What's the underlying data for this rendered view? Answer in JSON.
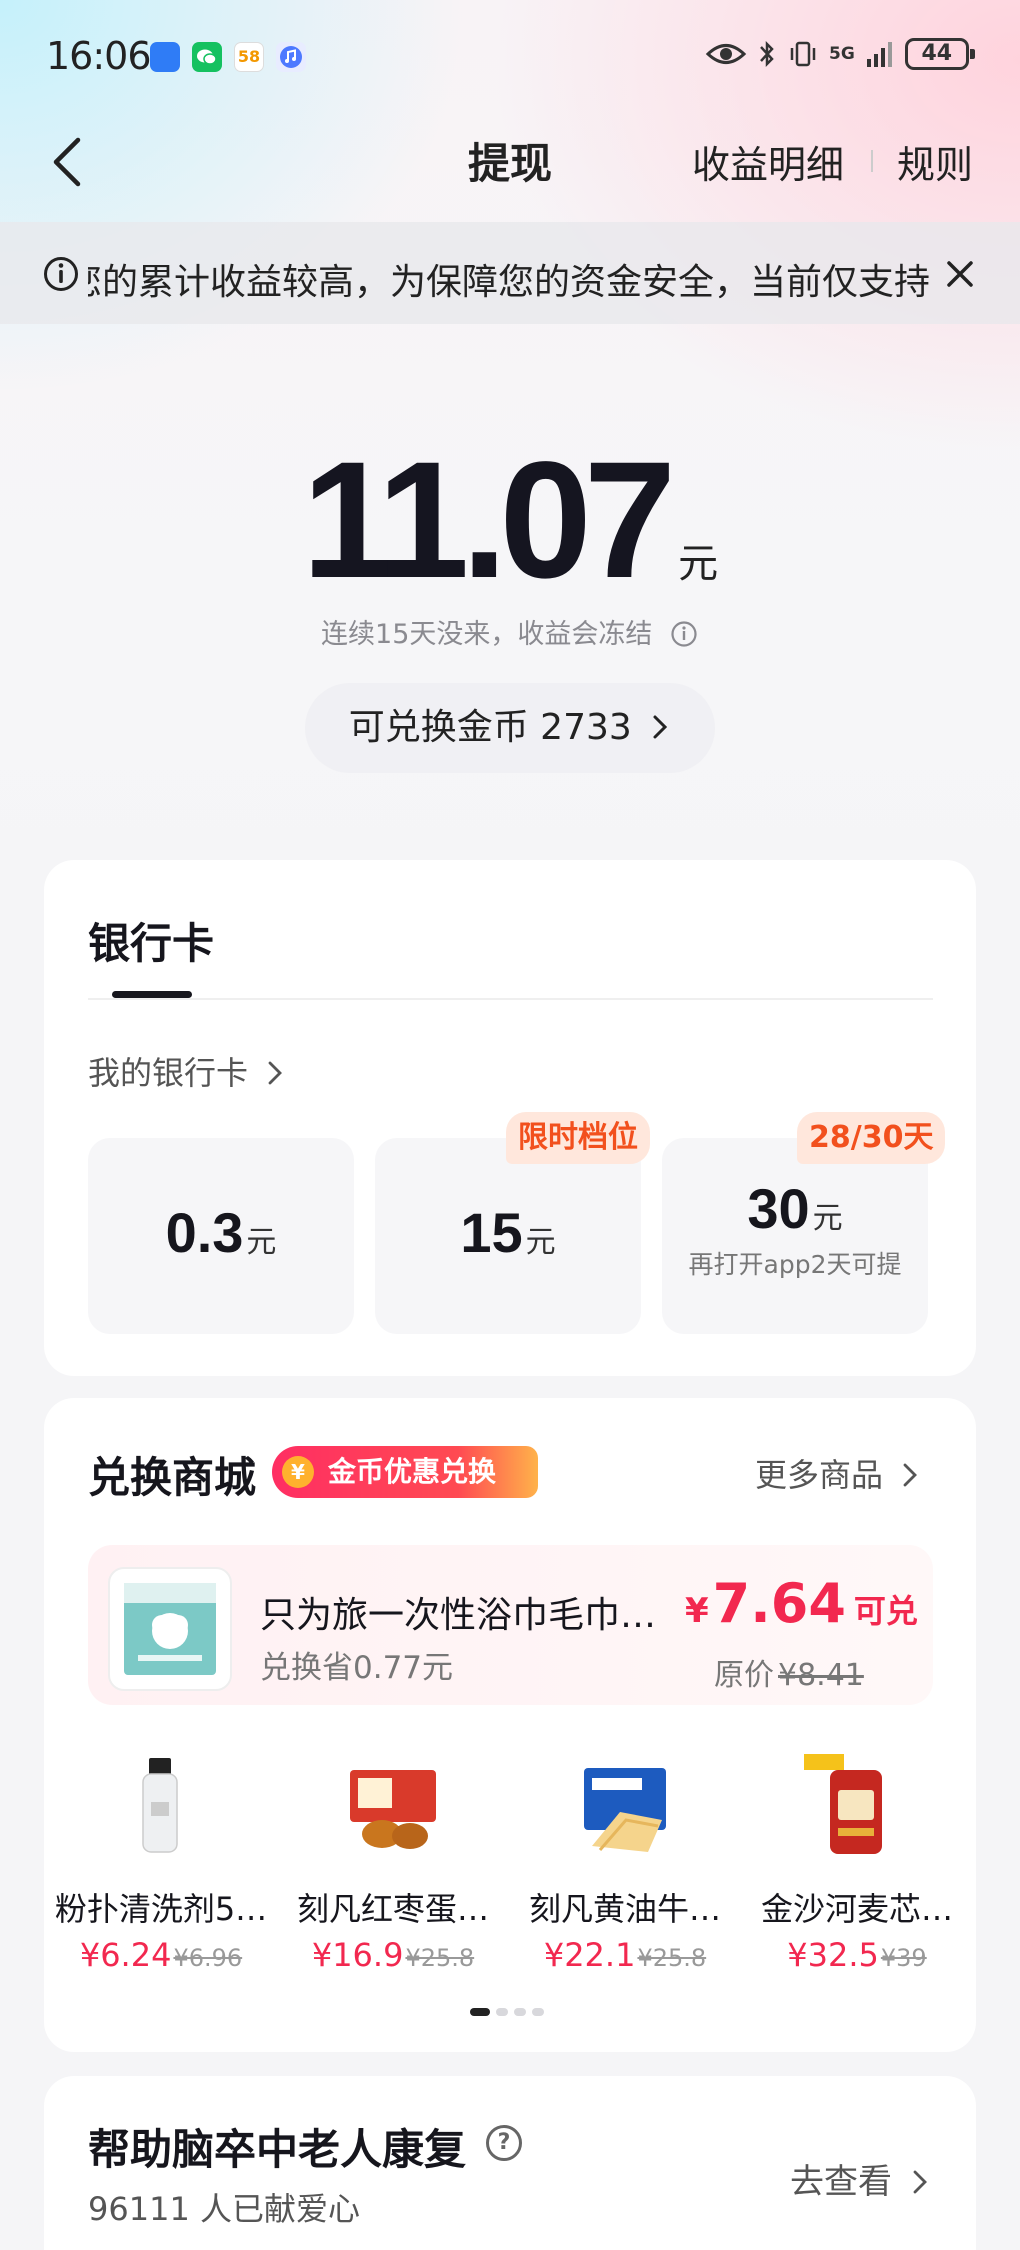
{
  "status_bar": {
    "time": "16:06",
    "network": "5G",
    "battery": "44",
    "app_icons": [
      "app-blue-icon",
      "wechat-icon",
      "58-icon",
      "music-icon"
    ]
  },
  "nav": {
    "title": "提现",
    "income_detail": "收益明细",
    "rules": "规则"
  },
  "notice": {
    "text": "您的累计收益较高，为保障您的资金安全，当前仅支持"
  },
  "balance": {
    "amount": "11.07",
    "unit": "元",
    "freeze_note": "连续15天没来，收益会冻结"
  },
  "coins": {
    "label": "可兑换金币 2733"
  },
  "bank": {
    "tab": "银行卡",
    "my_cards": "我的银行卡",
    "options": [
      {
        "value": "0.3",
        "unit": "元",
        "badge": "",
        "sub": ""
      },
      {
        "value": "15",
        "unit": "元",
        "badge": "限时档位",
        "sub": ""
      },
      {
        "value": "30",
        "unit": "元",
        "badge": "28/30天",
        "sub": "再打开app2天可提"
      }
    ]
  },
  "mall": {
    "title": "兑换商城",
    "promo_badge": "金币优惠兑换",
    "promo_coin_symbol": "¥",
    "more": "更多商品",
    "featured": {
      "name": "只为旅一次性浴巾毛巾…",
      "save": "兑换省0.77元",
      "currency": "¥",
      "price": "7.64",
      "price_suffix": "可兑",
      "orig_label": "原价",
      "orig_price": "¥8.41"
    },
    "products": [
      {
        "name": "粉扑清洗剂5…",
        "price": "¥6.24",
        "orig": "¥6.96"
      },
      {
        "name": "刻凡红枣蛋…",
        "price": "¥16.9",
        "orig": "¥25.8"
      },
      {
        "name": "刻凡黄油牛…",
        "price": "¥22.1",
        "orig": "¥25.8"
      },
      {
        "name": "金沙河麦芯…",
        "price": "¥32.5",
        "orig": "¥39"
      }
    ],
    "page_count": 4,
    "page_active": 1
  },
  "charity": {
    "title": "帮助脑卒中老人康复",
    "help_symbol": "?",
    "count": "96111 人已献爱心",
    "link": "去查看"
  },
  "colors": {
    "accent_red": "#f2284f",
    "badge_orange": "#f2501d",
    "badge_bg": "#ffe7dc",
    "text_dark": "#16161d"
  }
}
